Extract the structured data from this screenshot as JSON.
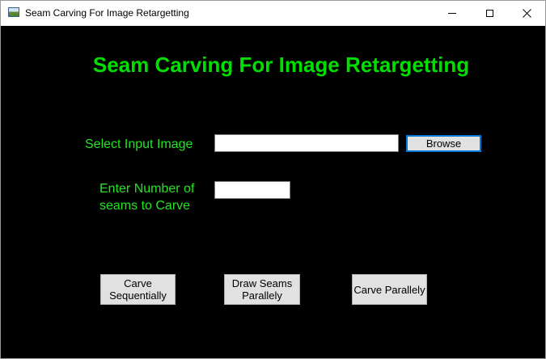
{
  "window": {
    "title": "Seam Carving For Image Retargetting",
    "controls": {
      "minimize": "minimize-icon",
      "maximize": "maximize-icon",
      "close_glyph": "✕"
    }
  },
  "main": {
    "heading": "Seam Carving For Image Retargetting",
    "input_image": {
      "label": "Select Input Image",
      "value": "",
      "browse_label": "Browse"
    },
    "seams": {
      "label": "Enter Number of seams to Carve",
      "value": ""
    },
    "actions": {
      "carve_sequentially": "Carve Sequentially",
      "draw_seams_parallely": "Draw Seams Parallely",
      "carve_parallely": "Carve Parallely"
    }
  },
  "colors": {
    "background": "#000000",
    "label_green": "#22e622",
    "heading_green": "#00e000",
    "focus_blue": "#0078d7"
  }
}
